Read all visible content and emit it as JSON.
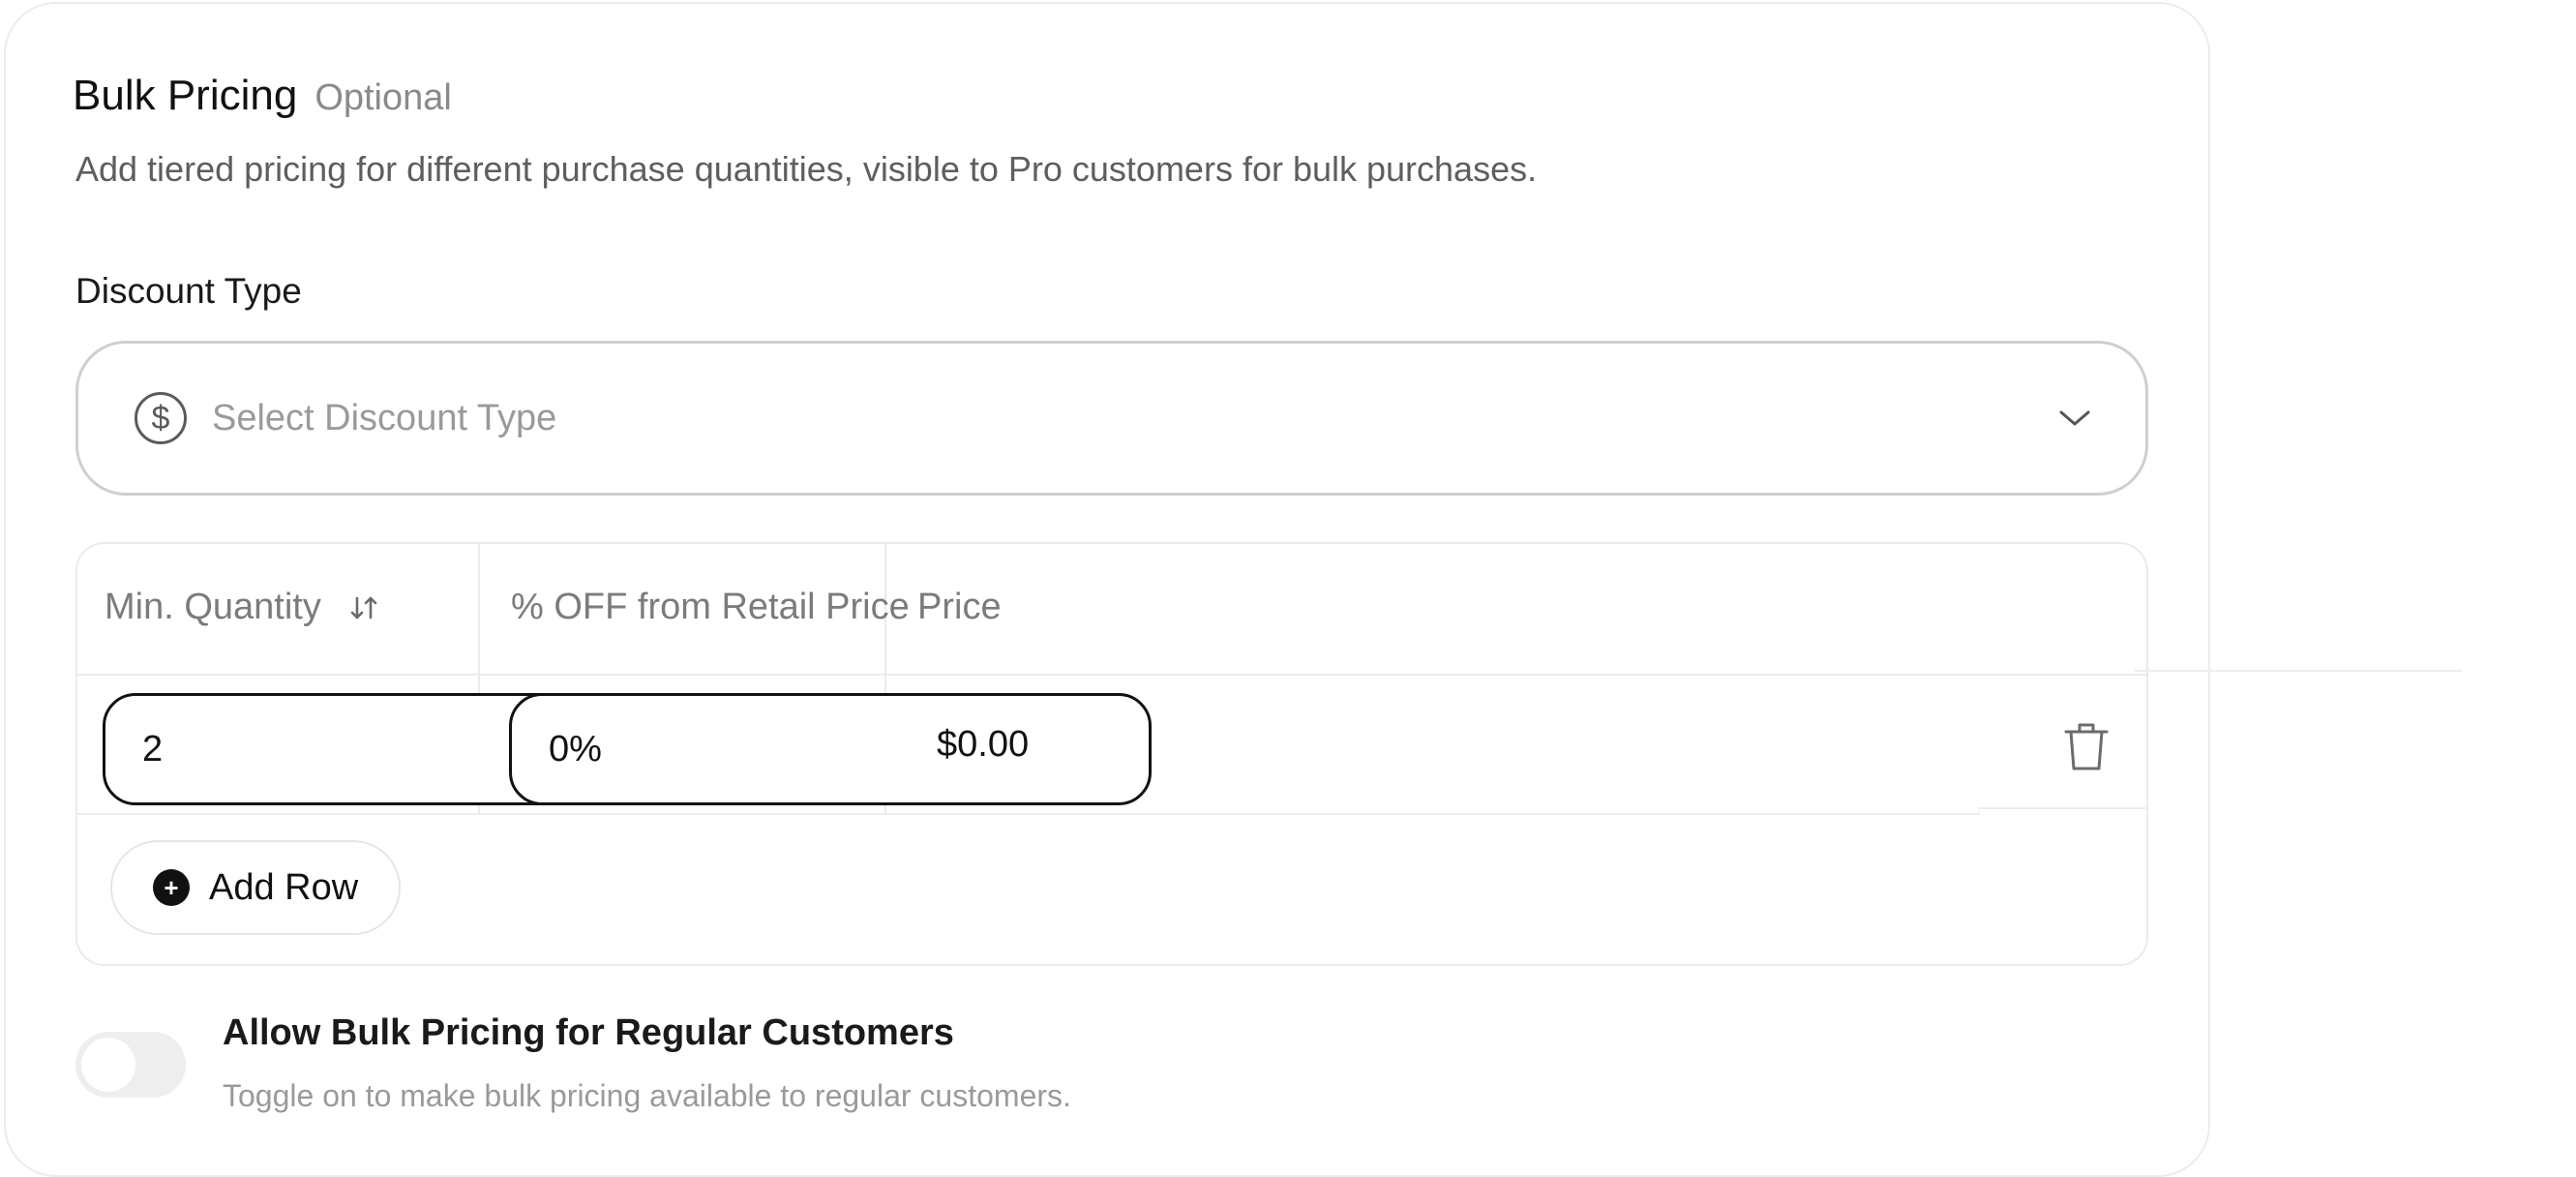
{
  "section": {
    "title": "Bulk Pricing",
    "optional_label": "Optional",
    "description": "Add tiered pricing for different purchase quantities, visible to Pro customers for bulk purchases."
  },
  "discount_type": {
    "label": "Discount Type",
    "placeholder": "Select Discount Type",
    "icon": "dollar-circle-icon",
    "dropdown_icon": "chevron-down-icon"
  },
  "table": {
    "columns": [
      "Min. Quantity",
      "% OFF from Retail Price",
      "Price"
    ],
    "sort_icon": "sort-arrows-icon",
    "rows": [
      {
        "min_quantity": "2",
        "percent_off": "0%",
        "price": "$0.00"
      }
    ],
    "delete_icon": "trash-icon",
    "add_row_label": "Add Row",
    "add_row_icon": "plus-circle-icon"
  },
  "regular_customers": {
    "title": "Allow Bulk Pricing for Regular Customers",
    "description": "Toggle on to make bulk pricing available to regular customers.",
    "enabled": false
  }
}
